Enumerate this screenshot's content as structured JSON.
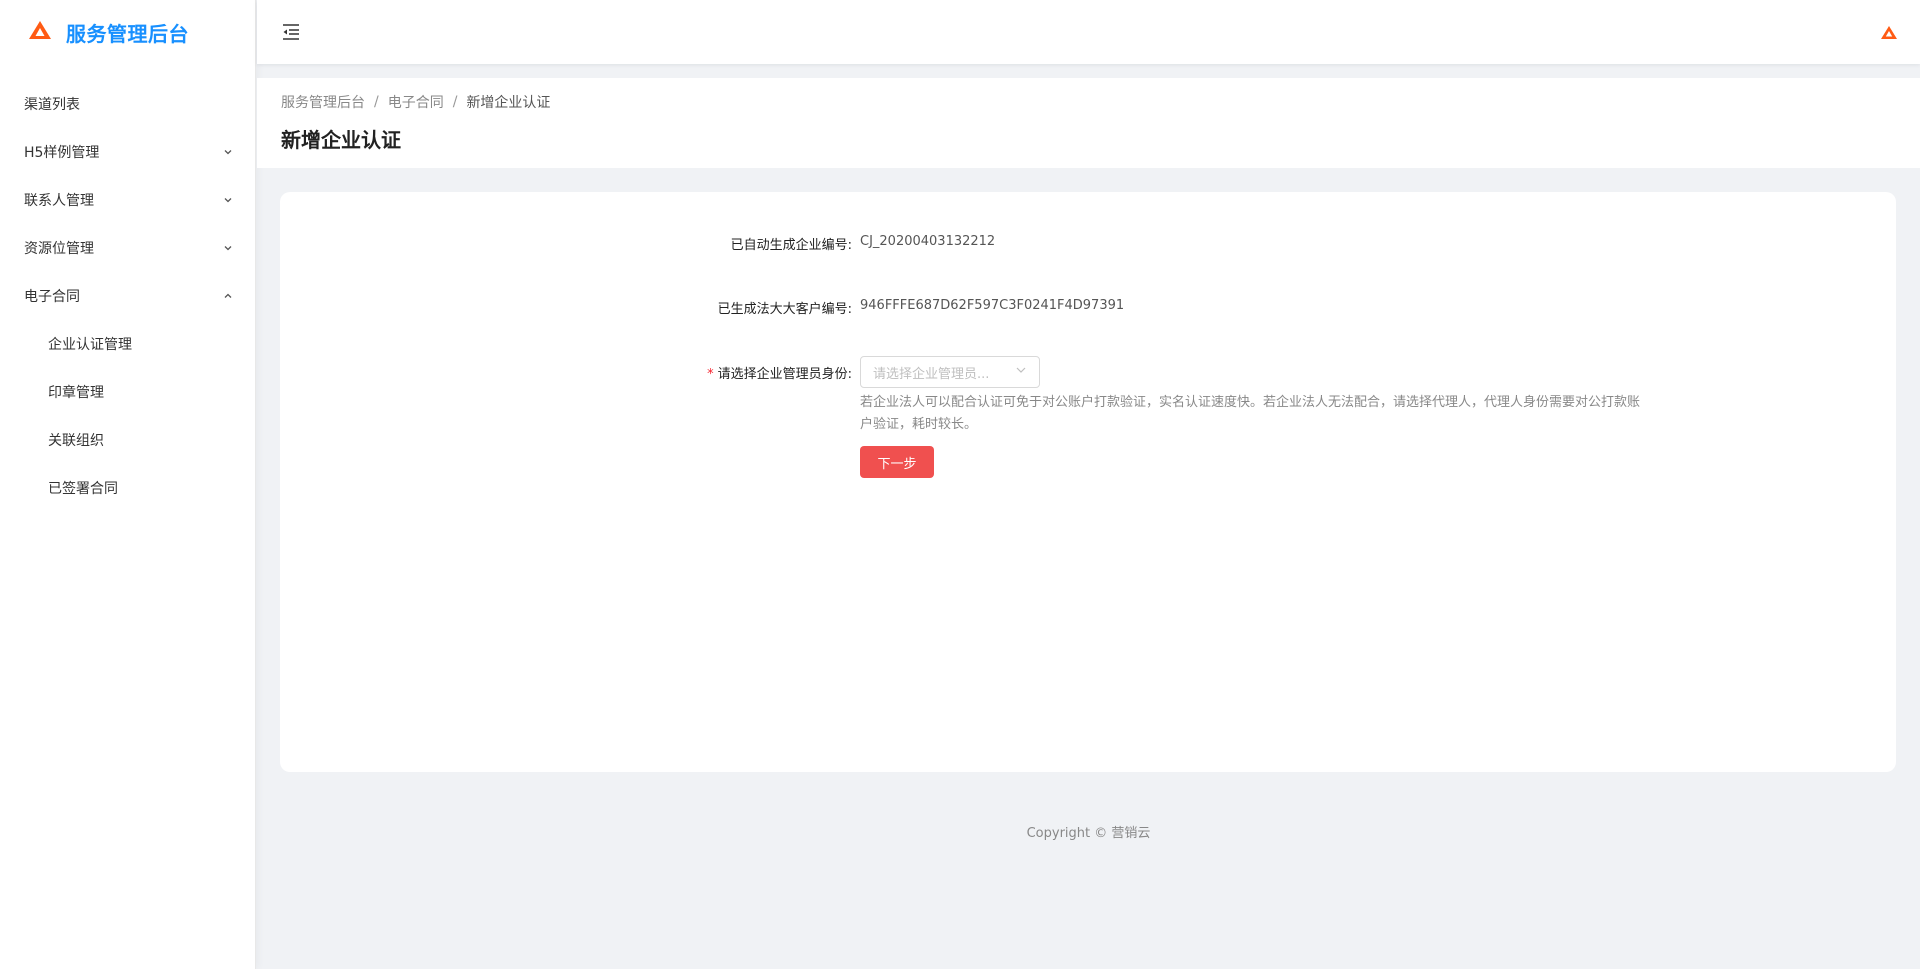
{
  "app": {
    "title": "服务管理后台",
    "brand_color": "#1890ff",
    "accent_color": "#f0504f",
    "logo_icon": "orange-triangle-logo"
  },
  "sidebar": {
    "items": [
      {
        "label": "渠道列表",
        "expandable": false
      },
      {
        "label": "H5样例管理",
        "expandable": true,
        "expanded": false
      },
      {
        "label": "联系人管理",
        "expandable": true,
        "expanded": false
      },
      {
        "label": "资源位管理",
        "expandable": true,
        "expanded": false
      },
      {
        "label": "电子合同",
        "expandable": true,
        "expanded": true,
        "children": [
          {
            "label": "企业认证管理"
          },
          {
            "label": "印章管理"
          },
          {
            "label": "关联组织"
          },
          {
            "label": "已签署合同"
          }
        ]
      }
    ]
  },
  "breadcrumb": {
    "items": [
      "服务管理后台",
      "电子合同",
      "新增企业认证"
    ],
    "separator": "/"
  },
  "page": {
    "title": "新增企业认证"
  },
  "form": {
    "enterprise_id_label": "已自动生成企业编号:",
    "enterprise_id_value": "CJ_20200403132212",
    "customer_id_label": "已生成法大大客户编号:",
    "customer_id_value": "946FFFE687D62F597C3F0241F4D97391",
    "admin_identity_required_mark": "*",
    "admin_identity_label": "请选择企业管理员身份:",
    "admin_identity_placeholder": "请选择企业管理员...",
    "admin_identity_hint": "若企业法人可以配合认证可免于对公账户打款验证，实名认证速度快。若企业法人无法配合，请选择代理人，代理人身份需要对公打款账户验证，耗时较长。",
    "next_button_label": "下一步"
  },
  "footer": {
    "copyright": "Copyright © 营销云"
  }
}
